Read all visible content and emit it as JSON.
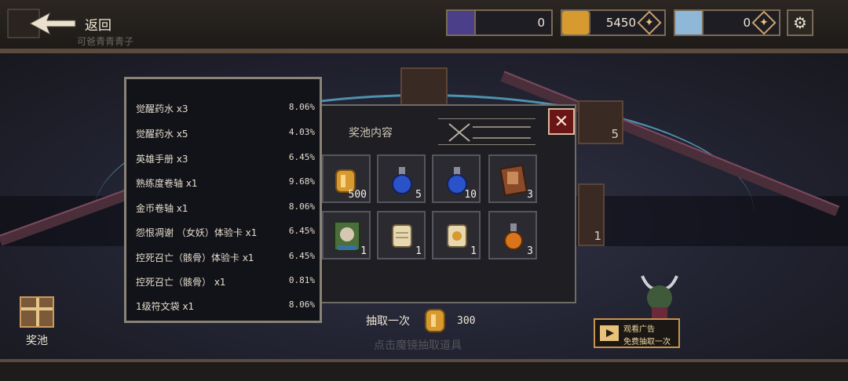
{
  "header": {
    "back_label": "返回",
    "sub_name": "可爸青青青子",
    "currencies": [
      {
        "icon": "gem-card-icon",
        "value": "0"
      },
      {
        "icon": "gold-coin-icon",
        "value": "5450"
      },
      {
        "icon": "diamond-icon",
        "value": "0"
      }
    ]
  },
  "sidebar": {
    "pool_label": "奖池"
  },
  "prize_panel": {
    "title": "奖池内容",
    "items": [
      {
        "icon": "gold-coin-icon",
        "qty": "500"
      },
      {
        "icon": "blue-potion-icon",
        "qty": "5"
      },
      {
        "icon": "blue-potion-icon",
        "qty": "10"
      },
      {
        "icon": "hero-book-icon",
        "qty": "3"
      },
      {
        "icon": "trial-card-icon",
        "qty": "1"
      },
      {
        "icon": "scroll-icon",
        "qty": "1"
      },
      {
        "icon": "gold-scroll-icon",
        "qty": "1"
      },
      {
        "icon": "orange-potion-icon",
        "qty": "3"
      }
    ]
  },
  "probabilities": [
    {
      "name": "觉醒药水 x3",
      "pct": "8.06%"
    },
    {
      "name": "觉醒药水 x5",
      "pct": "4.03%"
    },
    {
      "name": "英雄手册 x3",
      "pct": "6.45%"
    },
    {
      "name": "熟练度卷轴 x1",
      "pct": "9.68%"
    },
    {
      "name": "金币卷轴 x1",
      "pct": "8.06%"
    },
    {
      "name": "怨恨凋谢 （女妖）体验卡 x1",
      "pct": "6.45%"
    },
    {
      "name": "控死召亡（骸骨）体验卡 x1",
      "pct": "6.45%"
    },
    {
      "name": "控死召亡（骸骨） x1",
      "pct": "0.81%"
    },
    {
      "name": "1级符文袋 x1",
      "pct": "8.06%"
    }
  ],
  "draw": {
    "label": "抽取一次",
    "cost": "300",
    "hint": "点击魔镜抽取道具"
  },
  "ad": {
    "line1": "观看广告",
    "line2": "免费抽取一次"
  },
  "background": {
    "card_count": "5",
    "side_count": "1"
  },
  "colors": {
    "accent_gold": "#caa36a",
    "close_red": "#6a1616",
    "arc_blue": "#5fb8d9"
  }
}
